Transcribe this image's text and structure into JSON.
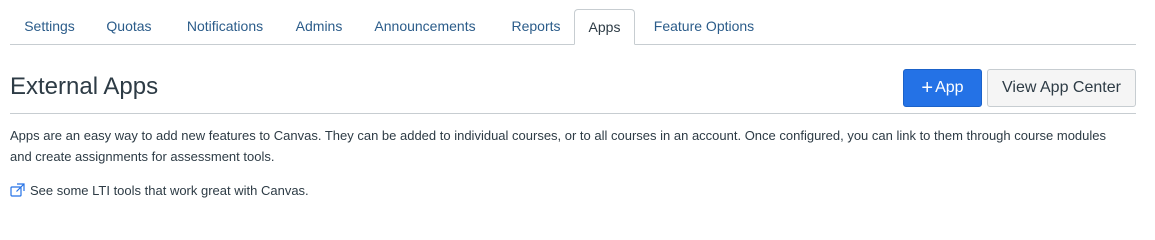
{
  "tabs": [
    {
      "label": "Settings"
    },
    {
      "label": "Quotas"
    },
    {
      "label": "Notifications"
    },
    {
      "label": "Admins"
    },
    {
      "label": "Announcements"
    },
    {
      "label": "Reports"
    },
    {
      "label": "Apps",
      "active": true
    },
    {
      "label": "Feature Options"
    }
  ],
  "header": {
    "title": "External Apps",
    "add_app_label": "App",
    "add_app_icon": "plus-icon",
    "view_app_center_label": "View App Center"
  },
  "description": "Apps are an easy way to add new features to Canvas. They can be added to individual courses, or to all courses in an account. Once configured, you can link to them through course modules and create assignments for assessment tools.",
  "lti_link": {
    "icon": "external-link-icon",
    "label": "See some LTI tools that work great with Canvas."
  },
  "colors": {
    "primary": "#2472e6",
    "link": "#2b5c8a",
    "text": "#2d3b45",
    "border": "#c7cdd1"
  }
}
